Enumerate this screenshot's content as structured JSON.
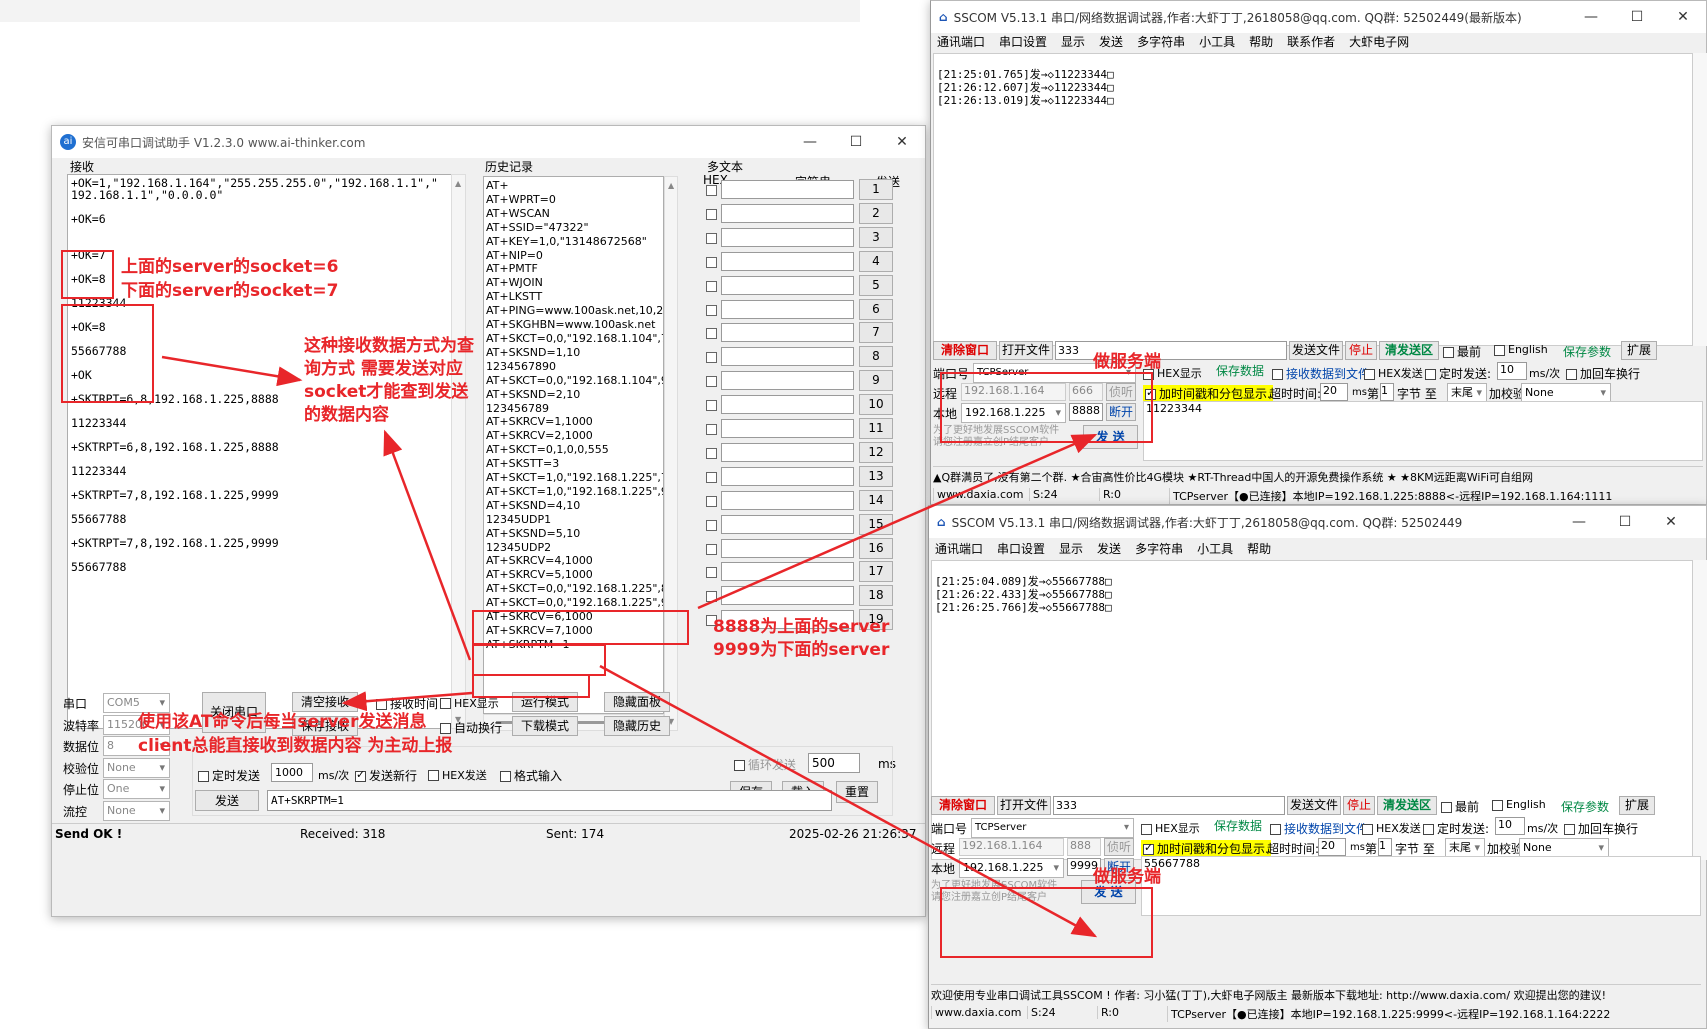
{
  "aithinker": {
    "title": "安信可串口调试助手 V1.2.3.0    www.ai-thinker.com",
    "recv_label": "接收",
    "history_label": "历史记录",
    "multi_label": "多文本",
    "hex_col": "HEX",
    "str_col": "字符串",
    "send_col": "发送",
    "recv_lines": [
      "+OK=1,\"192.168.1.164\",\"255.255.255.0\",\"192.168.1.1\",\"",
      "192.168.1.1\",\"0.0.0.0\"",
      "",
      "+OK=6",
      "",
      "",
      "+OK=7",
      "",
      "+OK=8",
      "",
      "11223344",
      "",
      "+OK=8",
      "",
      "55667788",
      "",
      "+OK",
      "",
      "+SKTRPT=6,8,192.168.1.225,8888",
      "",
      "11223344",
      "",
      "+SKTRPT=6,8,192.168.1.225,8888",
      "",
      "11223344",
      "",
      "+SKTRPT=7,8,192.168.1.225,9999",
      "",
      "55667788",
      "",
      "+SKTRPT=7,8,192.168.1.225,9999",
      "",
      "55667788"
    ],
    "history": [
      "AT+",
      "AT+WPRT=0",
      "AT+WSCAN",
      "AT+SSID=\"47322\"",
      "AT+KEY=1,0,\"13148672568\"",
      "AT+NIP=0",
      "AT+PMTF",
      "AT+WJOIN",
      "AT+LKSTT",
      "AT+PING=www.100ask.net,10,2,1",
      "AT+SKGHBN=www.100ask.net",
      "AT+SKCT=0,0,\"192.168.1.104\",777",
      "AT+SKSND=1,10",
      "1234567890",
      "AT+SKCT=0,0,\"192.168.1.104\",999",
      "AT+SKSND=2,10",
      "123456789",
      "AT+SKRCV=1,1000",
      "AT+SKRCV=2,1000",
      "AT+SKCT=0,1,0,0,555",
      "AT+SKSTT=3",
      "AT+SKCT=1,0,\"192.168.1.225\",777",
      "AT+SKCT=1,0,\"192.168.1.225\",999",
      "AT+SKSND=4,10",
      "12345UDP1",
      "AT+SKSND=5,10",
      "12345UDP2",
      "AT+SKRCV=4,1000",
      "AT+SKRCV=5,1000",
      "AT+SKCT=0,0,\"192.168.1.225\",888",
      "AT+SKCT=0,0,\"192.168.1.225\",999",
      "AT+SKRCV=6,1000",
      "AT+SKRCV=7,1000",
      "AT+SKRPTM=1"
    ],
    "send_buttons": [
      "1",
      "2",
      "3",
      "4",
      "5",
      "6",
      "7",
      "8",
      "9",
      "10",
      "11",
      "12",
      "13",
      "14",
      "15",
      "16",
      "17",
      "18",
      "19"
    ],
    "loop_send": "循环发送",
    "loop_ms": "500",
    "ms": "ms",
    "save": "保存",
    "load": "载入",
    "reset": "重置",
    "port_label": "串口",
    "port_val": "COM5",
    "baud_label": "波特率",
    "baud_val": "115200",
    "databits_label": "数据位",
    "databits_val": "8",
    "parity_label": "校验位",
    "parity_val": "None",
    "stopbits_label": "停止位",
    "stopbits_val": "One",
    "flow_label": "流控",
    "flow_val": "None",
    "close_port": "关闭串口",
    "clear_recv": "清空接收",
    "save_recv": "保存接收",
    "recv_time": "接收时间",
    "hex_show": "HEX显示",
    "auto_newline": "自动换行",
    "run_mode": "运行模式",
    "download_mode": "下载模式",
    "hide_panel": "隐藏面板",
    "hide_history": "隐藏历史",
    "timed_send": "定时发送",
    "timed_val": "1000",
    "ms_per": "ms/次",
    "send_newline": "发送新行",
    "hex_send": "HEX发送",
    "format_input": "格式输入",
    "send_btn": "发送",
    "send_text": "AT+SKRPTM=1",
    "status_ok": "Send OK !",
    "received": "Received: 318",
    "sent": "Sent: 174",
    "datetime": "2025-02-26 21:26:37"
  },
  "sscom_top": {
    "title": "SSCOM V5.13.1 串口/网络数据调试器,作者:大虾丁丁,2618058@qq.com. QQ群: 52502449(最新版本)",
    "menu": [
      "通讯端口",
      "串口设置",
      "显示",
      "发送",
      "多字符串",
      "小工具",
      "帮助",
      "联系作者",
      "大虾电子网"
    ],
    "log": [
      "[21:25:01.765]发→◇11223344□",
      "[21:26:12.607]发→◇11223344□",
      "[21:26:13.019]发→◇11223344□"
    ],
    "remote_ip": "192.168.1.164",
    "remote_port": "666",
    "local_ip": "192.168.1.225",
    "local_port": "8888",
    "send_text": "11223344",
    "ad": "为了更好地发展SSCOM软件\n请您注册嘉立创P结尾客户",
    "ticker": "▲Q群满员了,没有第二个群. ★合宙高性价比4G模块 ★RT-Thread中国人的开源免费操作系统 ★ ★8KM远距离WiFi可自组网",
    "status": [
      "www.daxia.com",
      "S:24",
      "R:0",
      "TCPserver【●已连接】本地IP=192.168.1.225:8888<-远程IP=192.168.1.164:1111"
    ]
  },
  "sscom_bottom": {
    "title": "SSCOM V5.13.1 串口/网络数据调试器,作者:大虾丁丁,2618058@qq.com. QQ群: 52502449",
    "menu": [
      "通讯端口",
      "串口设置",
      "显示",
      "发送",
      "多字符串",
      "小工具",
      "帮助"
    ],
    "log": [
      "[21:25:04.089]发→◇55667788□",
      "[21:26:22.433]发→◇55667788□",
      "[21:26:25.766]发→◇55667788□"
    ],
    "remote_ip": "192.168.1.164",
    "remote_port": "888",
    "local_ip": "192.168.1.225",
    "local_port": "9999",
    "send_text": "55667788",
    "ad": "为了更好地发展SSCOM软件\n请您注册嘉立创P结尾客户",
    "ticker": "欢迎使用专业串口调试工具SSCOM ! 作者: 习小猛(丁丁),大虾电子网版主 最新版本下载地址: http://www.daxia.com/ 欢迎提出您的建议!",
    "status": [
      "www.daxia.com",
      "S:24",
      "R:0",
      "TCPserver【●已连接】本地IP=192.168.1.225:9999<-远程IP=192.168.1.164:2222"
    ]
  },
  "sscom_common": {
    "clear_window": "清除窗口",
    "open_file": "打开文件",
    "file_val": "333",
    "send_file": "发送文件",
    "stop": "停止",
    "clear_send": "清发送区",
    "latest": "最前",
    "english": "English",
    "save_params": "保存参数",
    "expand": "扩展",
    "port_no": "端口号",
    "mode": "TCPServer",
    "hex_show": "HEX显示",
    "save_data": "保存数据",
    "recv_to_file": "接收数据到文件",
    "hex_send": "HEX发送",
    "timed_send": "定时发送:",
    "timed_val": "10",
    "ms_per": "ms/次",
    "add_crlf": "加回车换行",
    "remote": "远程",
    "listen": "侦听",
    "local": "本地",
    "disconnect": "断开",
    "timestamp": "加时间戳和分包显示.",
    "timeout": "超时时间:",
    "timeout_val": "20",
    "ms": "ms",
    "nth": "第",
    "nth_val": "1",
    "byte_to": "字节 至",
    "end": "末尾",
    "checksum": "加校验",
    "checksum_val": "None",
    "send": "发 送"
  },
  "annotations": {
    "socket_note_1": "上面的server的socket=6",
    "socket_note_2": "下面的server的socket=7",
    "query_note": "这种接收数据方式为查询方式 需要发送对应socket才能查到发送的数据内容",
    "server_note_1": "8888为上面的server",
    "server_note_2": "9999为下面的server",
    "report_note_1": "使用该AT命令后每当server发送消息",
    "report_note_2": "client总能直接收到数据内容 为主动上报",
    "server_tag": "做服务端"
  },
  "colors": {
    "red": "#e8262a",
    "accent_yellow": "#ffff00",
    "green": "#007a00"
  }
}
